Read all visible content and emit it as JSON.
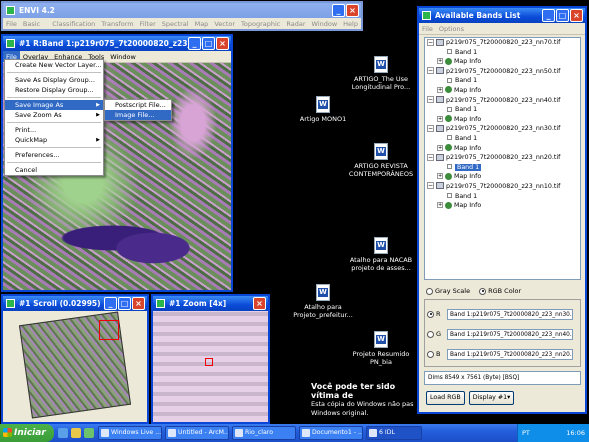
{
  "envi": {
    "title": "ENVI 4.2",
    "menu": [
      "File",
      "Basic Tools",
      "Classification",
      "Transform",
      "Filter",
      "Spectral",
      "Map",
      "Vector",
      "Topographic",
      "Radar",
      "Window",
      "Help"
    ]
  },
  "display": {
    "title": "#1 R:Band 1:p219r075_7t20000820_z23_nn3...",
    "menu": [
      "File",
      "Overlay",
      "Enhance",
      "Tools",
      "Window"
    ]
  },
  "file_menu": {
    "items": [
      "Create New Vector Layer...",
      "Save As Display Group...",
      "Restore Display Group...",
      "Save Image As",
      "Save Zoom As",
      "Print...",
      "QuickMap",
      "Preferences...",
      "Cancel"
    ]
  },
  "save_image_submenu": {
    "items": [
      "Postscript File...",
      "Image File..."
    ]
  },
  "scroll_window": {
    "title": "#1 Scroll (0.02995)"
  },
  "zoom_window": {
    "title": "#1 Zoom [4x]"
  },
  "bands": {
    "title": "Available Bands List",
    "menu": [
      "File",
      "Options"
    ],
    "files": [
      "p219r075_7t20000820_z23_nn70.tif",
      "p219r075_7t20000820_z23_nn50.tif",
      "p219r075_7t20000820_z23_nn40.tif",
      "p219r075_7t20000820_z23_nn30.tif",
      "p219r075_7t20000820_z23_nn20.tif",
      "p219r075_7t20000820_z23_nn10.tif"
    ],
    "band_label": "Band 1",
    "mapinfo_label": "Map Info",
    "gray_scale": "Gray Scale",
    "rgb_color": "RGB Color",
    "r_label": "R",
    "g_label": "G",
    "b_label": "B",
    "r_value": "Band 1:p219r075_7t20000820_z23_nn30.tif",
    "g_value": "Band 1:p219r075_7t20000820_z23_nn40.tif",
    "b_value": "Band 1:p219r075_7t20000820_z23_nn20.tif",
    "dims": "Dims 8549 x 7561 (Byte) [BSQ]",
    "load_button": "Load RGB",
    "display_button": "Display #1▾"
  },
  "desktop": {
    "icons": [
      "ARTIGO_The Use Longitudinal Pro...",
      "Artigo MONO1",
      "ARTIGO REVISTA CONTEMPORÂNEOS",
      "Atalho para NACAB projeto de asses...",
      "Atalho para Projeto_prefeitur...",
      "Projeto Resumido PN_bia"
    ],
    "message_big": "Você pode ter sido vítima de",
    "message_small": "Esta cópia do Windows não pas Windows original."
  },
  "taskbar": {
    "start": "Iniciar",
    "tasks": [
      "Windows Live ...",
      "Untitled - ArcM...",
      "Rio_claro",
      "Documento1 - ...",
      "6 IDL"
    ],
    "lang": "PT",
    "clock": "16:06"
  }
}
